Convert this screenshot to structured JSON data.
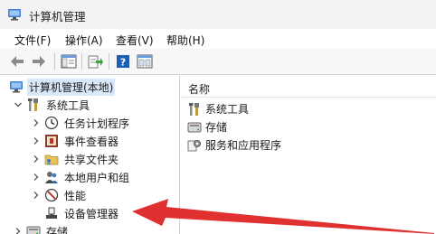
{
  "window": {
    "title": "计算机管理"
  },
  "menu": {
    "items": [
      {
        "label": "文件(F)"
      },
      {
        "label": "操作(A)"
      },
      {
        "label": "查看(V)"
      },
      {
        "label": "帮助(H)"
      }
    ]
  },
  "toolbar": {
    "buttons": [
      "back-icon",
      "forward-icon",
      "show-hide-tree-icon",
      "export-list-icon",
      "help-icon",
      "properties-icon"
    ]
  },
  "tree": {
    "root": {
      "label": "计算机管理(本地)",
      "icon": "computer-management-icon"
    },
    "system_tools": {
      "label": "系统工具",
      "icon": "tools-icon"
    },
    "children": [
      {
        "label": "任务计划程序",
        "icon": "clock-icon"
      },
      {
        "label": "事件查看器",
        "icon": "event-viewer-icon"
      },
      {
        "label": "共享文件夹",
        "icon": "shared-folder-icon"
      },
      {
        "label": "本地用户和组",
        "icon": "users-icon"
      },
      {
        "label": "性能",
        "icon": "performance-icon"
      },
      {
        "label": "设备管理器",
        "icon": "device-manager-icon"
      }
    ],
    "storage": {
      "label": "存储",
      "icon": "storage-icon"
    }
  },
  "list": {
    "column_header": "名称",
    "items": [
      {
        "label": "系统工具",
        "icon": "tools-icon"
      },
      {
        "label": "存储",
        "icon": "storage-icon"
      },
      {
        "label": "服务和应用程序",
        "icon": "services-icon"
      }
    ]
  },
  "colors": {
    "annotation_arrow": "#e03030",
    "selection": "#d9e8f8",
    "help_icon": "#1e5fb4"
  }
}
